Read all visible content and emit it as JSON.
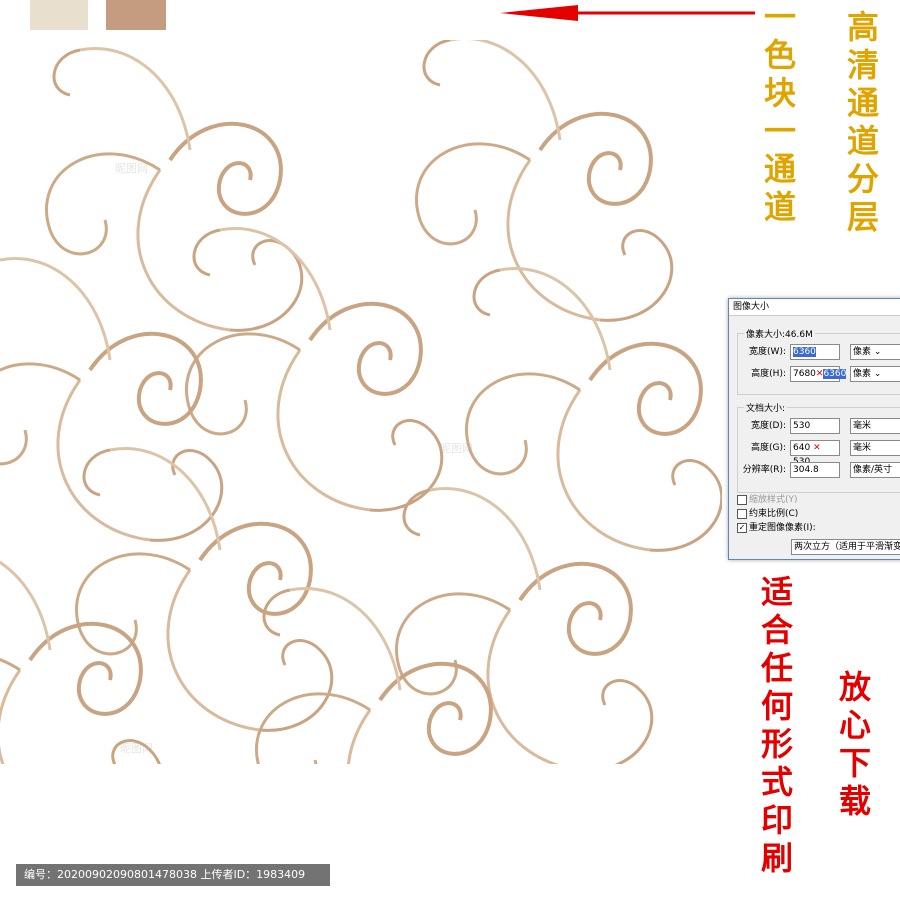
{
  "colors": {
    "swatch_light": "#e9dfcf",
    "swatch_dark": "#c59c7f",
    "accent_gold": "#e0a400",
    "accent_red": "#e50000",
    "ornament": "#c9a482"
  },
  "side_text": {
    "one_color_one_channel": "一色块一通道",
    "hd_channel_layers": "高清通道分层",
    "suitable_any_print": "适合任何形式印刷",
    "download_freely": "放心下载"
  },
  "dialog": {
    "title": "图像大小",
    "pixel_size_label": "像素大小:46.6M",
    "width_label": "宽度(W):",
    "width_value": "6360",
    "width_unit": "像素",
    "height_label": "高度(H):",
    "height_value_old": "7680",
    "height_value_new": "6360",
    "height_unit": "像素",
    "doc_size_label": "文档大小:",
    "doc_width_label": "宽度(D):",
    "doc_width_value": "530",
    "doc_width_unit": "毫米",
    "doc_height_label": "高度(G):",
    "doc_height_value_old": "640",
    "doc_height_value_new": "530",
    "doc_height_unit": "毫米",
    "resolution_label": "分辨率(R):",
    "resolution_value": "304.8",
    "resolution_unit": "像素/英寸",
    "scale_styles_label": "缩放样式(Y)",
    "constrain_label": "约束比例(C)",
    "resample_label": "重定图像像素(I):",
    "resample_method": "两次立方（适用于平滑渐变"
  },
  "footer": {
    "info": "编号：20200902090801478038 上传者ID：1983409"
  }
}
